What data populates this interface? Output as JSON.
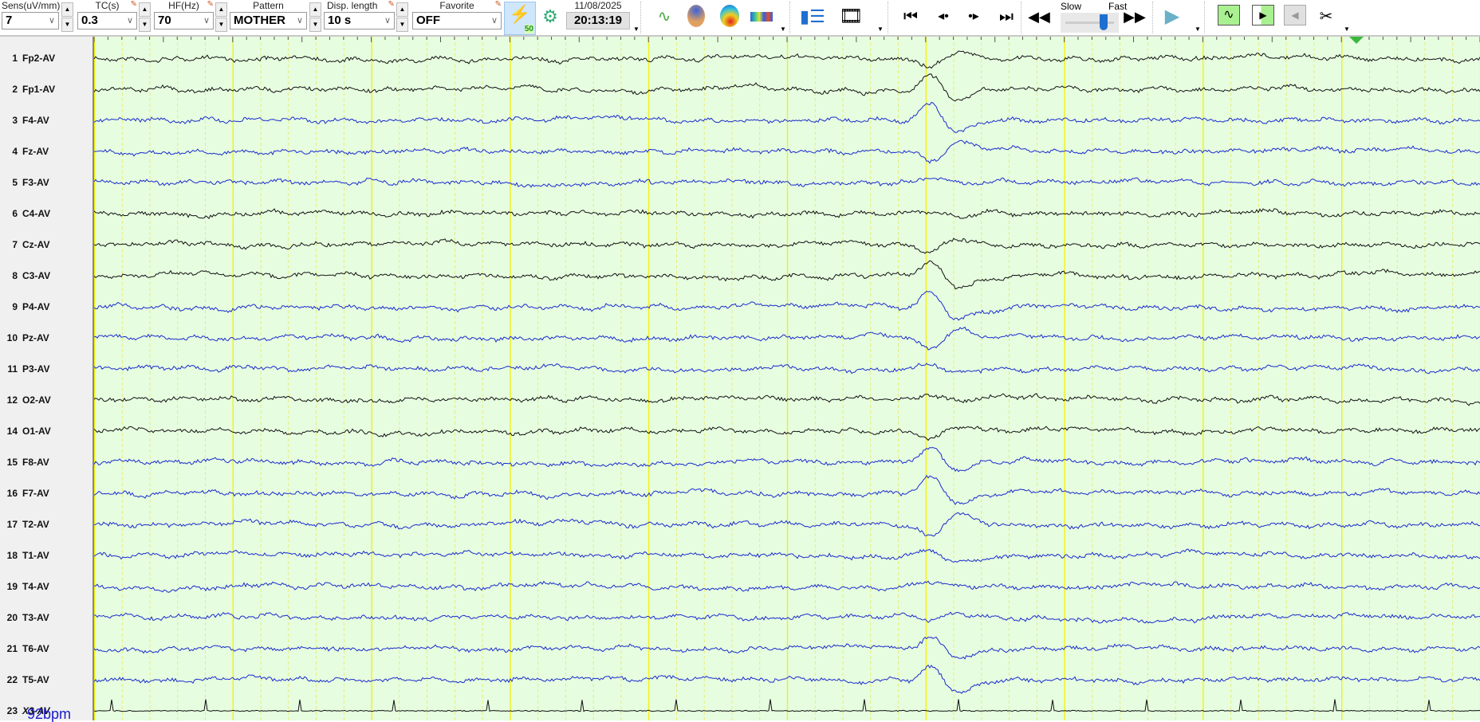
{
  "toolbar": {
    "sens": {
      "label": "Sens(uV/mm)",
      "value": "7"
    },
    "tc": {
      "label": "TC(s)",
      "value": "0.3"
    },
    "hf": {
      "label": "HF(Hz)",
      "value": "70"
    },
    "pattern": {
      "label": "Pattern",
      "value": "MOTHER"
    },
    "disp": {
      "label": "Disp. length",
      "value": "10 s"
    },
    "favorite": {
      "label": "Favorite",
      "value": "OFF"
    },
    "filter_badge": "50",
    "date": "11/08/2025",
    "time": "20:13:19",
    "speed": {
      "slow": "Slow",
      "fast": "Fast",
      "value": 0.85
    }
  },
  "channels": [
    {
      "num": "1",
      "name": "Fp2-AV",
      "color": "#111111"
    },
    {
      "num": "2",
      "name": "Fp1-AV",
      "color": "#111111"
    },
    {
      "num": "3",
      "name": "F4-AV",
      "color": "#1a2bcc"
    },
    {
      "num": "4",
      "name": "Fz-AV",
      "color": "#1a2bcc"
    },
    {
      "num": "5",
      "name": "F3-AV",
      "color": "#1a2bcc"
    },
    {
      "num": "6",
      "name": "C4-AV",
      "color": "#111111"
    },
    {
      "num": "7",
      "name": "Cz-AV",
      "color": "#111111"
    },
    {
      "num": "8",
      "name": "C3-AV",
      "color": "#111111"
    },
    {
      "num": "9",
      "name": "P4-AV",
      "color": "#1a2bcc"
    },
    {
      "num": "10",
      "name": "Pz-AV",
      "color": "#1a2bcc"
    },
    {
      "num": "11",
      "name": "P3-AV",
      "color": "#1a2bcc"
    },
    {
      "num": "12",
      "name": "O2-AV",
      "color": "#111111"
    },
    {
      "num": "14",
      "name": "O1-AV",
      "color": "#111111"
    },
    {
      "num": "15",
      "name": "F8-AV",
      "color": "#1a2bcc"
    },
    {
      "num": "16",
      "name": "F7-AV",
      "color": "#1a2bcc"
    },
    {
      "num": "17",
      "name": "T2-AV",
      "color": "#1a2bcc"
    },
    {
      "num": "18",
      "name": "T1-AV",
      "color": "#1a2bcc"
    },
    {
      "num": "19",
      "name": "T4-AV",
      "color": "#1a2bcc"
    },
    {
      "num": "20",
      "name": "T3-AV",
      "color": "#1a2bcc"
    },
    {
      "num": "21",
      "name": "T6-AV",
      "color": "#1a2bcc"
    },
    {
      "num": "22",
      "name": "T5-AV",
      "color": "#1a2bcc"
    },
    {
      "num": "23",
      "name": "X3-AV",
      "color": "#111111",
      "ecg": true
    }
  ],
  "heart_rate": "92bpm",
  "display_seconds": 10,
  "colors": {
    "background": "#e6fde0",
    "grid_major": "#f2f200",
    "grid_minor": "#e8e860"
  }
}
